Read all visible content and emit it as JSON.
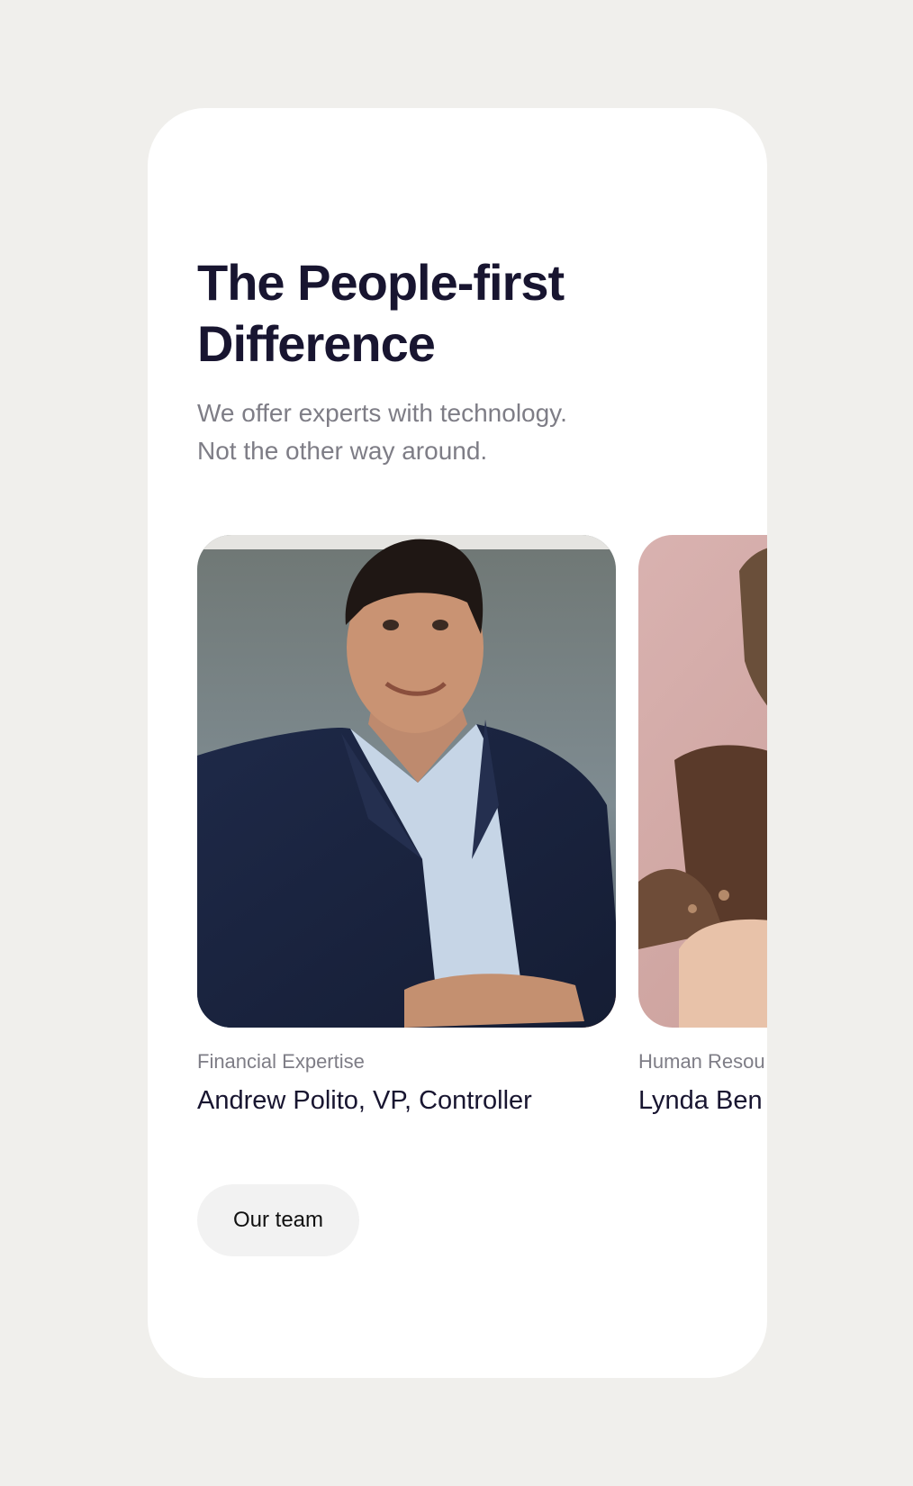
{
  "section": {
    "title": "The People-first Difference",
    "subtitle_lines": [
      "We offer experts with technology.",
      "Not the other way around."
    ]
  },
  "team_members": [
    {
      "label": "Financial Expertise",
      "name": "Andrew Polito, VP, Controller"
    },
    {
      "label": "Human Resou",
      "name": "Lynda Ben"
    }
  ],
  "actions": {
    "team_button_label": "Our team"
  },
  "colors": {
    "page_background": "#f0efec",
    "card_background": "#ffffff",
    "heading": "#181530",
    "muted_text": "#7e7d86",
    "button_background": "#f2f2f2"
  },
  "icons": [
    "portrait-photo-andrew-polito",
    "portrait-photo-lynda"
  ]
}
